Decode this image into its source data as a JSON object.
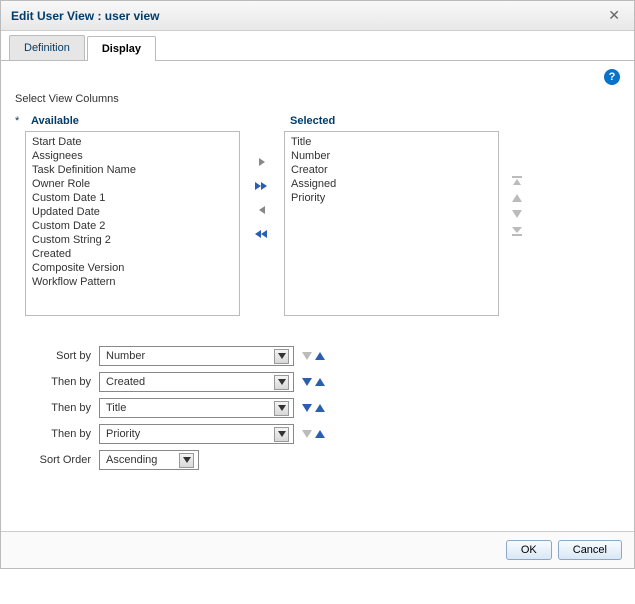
{
  "title": "Edit User View : user view",
  "tabs": {
    "definition": "Definition",
    "display": "Display"
  },
  "section_label": "Select View Columns",
  "required_marker": "*",
  "headers": {
    "available": "Available",
    "selected": "Selected"
  },
  "available_items": [
    "Start Date",
    "Assignees",
    "Task Definition Name",
    "Owner Role",
    "Custom Date 1",
    "Updated Date",
    "Custom Date 2",
    "Custom String 2",
    "Created",
    "Composite Version",
    "Workflow Pattern"
  ],
  "selected_items": [
    "Title",
    "Number",
    "Creator",
    "Assigned",
    "Priority"
  ],
  "sort": {
    "labels": {
      "sort_by": "Sort by",
      "then_by": "Then by",
      "sort_order": "Sort Order"
    },
    "rows": [
      {
        "label_key": "sort_by",
        "value": "Number",
        "asc_active": false,
        "desc_active": true
      },
      {
        "label_key": "then_by",
        "value": "Created",
        "asc_active": true,
        "desc_active": true
      },
      {
        "label_key": "then_by",
        "value": "Title",
        "asc_active": true,
        "desc_active": true
      },
      {
        "label_key": "then_by",
        "value": "Priority",
        "asc_active": false,
        "desc_active": true
      }
    ],
    "order_value": "Ascending"
  },
  "buttons": {
    "ok": "OK",
    "cancel": "Cancel"
  }
}
